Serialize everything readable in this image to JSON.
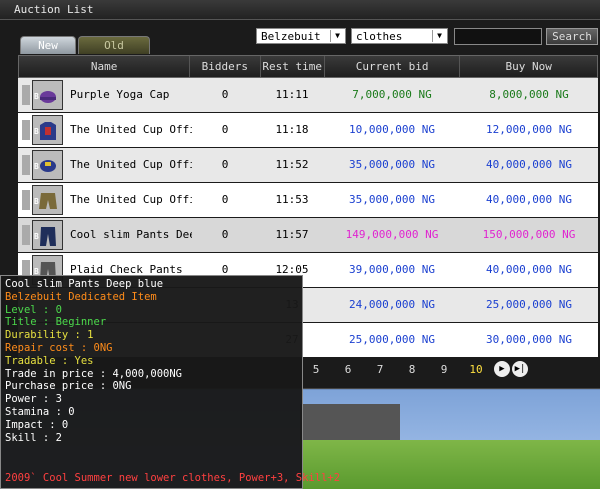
{
  "window": {
    "title": "Auction List"
  },
  "tabs": [
    {
      "label": "New"
    },
    {
      "label": "Old"
    }
  ],
  "filters": {
    "server": "Belzebuit",
    "category": "clothes",
    "search_value": "",
    "search_label": "Search"
  },
  "table": {
    "headers": [
      "Name",
      "Bidders",
      "Rest time",
      "Current bid",
      "Buy Now"
    ],
    "rows": [
      {
        "name": "Purple Yoga Cap",
        "bidders": "0",
        "rest": "11:11",
        "bid": "7,000,000 NG",
        "buy": "8,000,000 NG"
      },
      {
        "name": "The United Cup Officia",
        "bidders": "0",
        "rest": "11:18",
        "bid": "10,000,000 NG",
        "buy": "12,000,000 NG"
      },
      {
        "name": "The United Cup Officia",
        "bidders": "0",
        "rest": "11:52",
        "bid": "35,000,000 NG",
        "buy": "40,000,000 NG"
      },
      {
        "name": "The United Cup Officia",
        "bidders": "0",
        "rest": "11:53",
        "bid": "35,000,000 NG",
        "buy": "40,000,000 NG"
      },
      {
        "name": "Cool slim Pants Deep b",
        "bidders": "0",
        "rest": "11:57",
        "bid": "149,000,000 NG",
        "buy": "150,000,000 NG"
      },
      {
        "name": "Plaid Check Pants",
        "bidders": "0",
        "rest": "12:05",
        "bid": "39,000,000 NG",
        "buy": "40,000,000 NG"
      },
      {
        "name": "",
        "bidders": "",
        "rest": "13",
        "bid": "24,000,000 NG",
        "buy": "25,000,000 NG"
      },
      {
        "name": "",
        "bidders": "",
        "rest": "27",
        "bid": "25,000,000 NG",
        "buy": "30,000,000 NG"
      }
    ]
  },
  "pager": {
    "pages": [
      "5",
      "6",
      "7",
      "8",
      "9",
      "10"
    ],
    "current": "10",
    "next": "▶",
    "last": "▶|"
  },
  "tooltip": {
    "lines": [
      "Cool slim Pants Deep blue",
      "Belzebuit Dedicated Item",
      "Level : 0",
      "Title : Beginner",
      "Durability : 1",
      "Repair cost : 0NG",
      "Tradable : Yes",
      "Trade in price : 4,000,000NG",
      "Purchase price : 0NG",
      "Power : 3",
      "Stamina : 0",
      "Impact : 0",
      "Skill : 2"
    ],
    "footer": "2009` Cool Summer new lower clothes, Power+3, Skill+2"
  },
  "colors": {
    "green": "#1a7a1a",
    "blue": "#1a3fd0",
    "magenta": "#e024d0",
    "orange": "#ff8c1a",
    "red": "#ff4040"
  }
}
